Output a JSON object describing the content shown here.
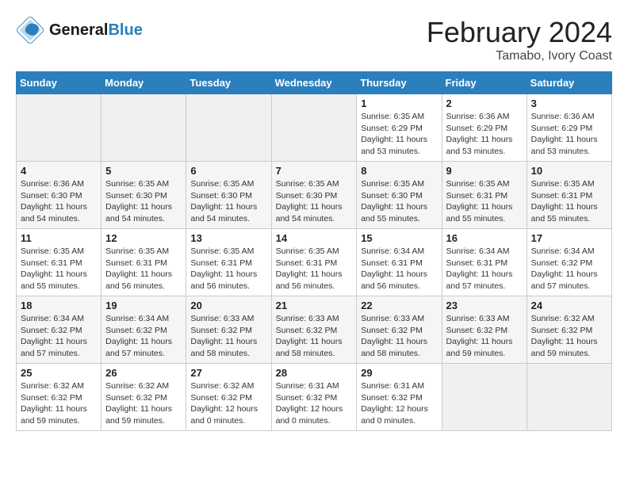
{
  "header": {
    "logo_line1": "General",
    "logo_line2": "Blue",
    "title": "February 2024",
    "subtitle": "Tamabo, Ivory Coast"
  },
  "days_of_week": [
    "Sunday",
    "Monday",
    "Tuesday",
    "Wednesday",
    "Thursday",
    "Friday",
    "Saturday"
  ],
  "weeks": [
    [
      {
        "day": "",
        "empty": true
      },
      {
        "day": "",
        "empty": true
      },
      {
        "day": "",
        "empty": true
      },
      {
        "day": "",
        "empty": true
      },
      {
        "day": "1",
        "sunrise": "Sunrise: 6:35 AM",
        "sunset": "Sunset: 6:29 PM",
        "daylight": "Daylight: 11 hours and 53 minutes."
      },
      {
        "day": "2",
        "sunrise": "Sunrise: 6:36 AM",
        "sunset": "Sunset: 6:29 PM",
        "daylight": "Daylight: 11 hours and 53 minutes."
      },
      {
        "day": "3",
        "sunrise": "Sunrise: 6:36 AM",
        "sunset": "Sunset: 6:29 PM",
        "daylight": "Daylight: 11 hours and 53 minutes."
      }
    ],
    [
      {
        "day": "4",
        "sunrise": "Sunrise: 6:36 AM",
        "sunset": "Sunset: 6:30 PM",
        "daylight": "Daylight: 11 hours and 54 minutes."
      },
      {
        "day": "5",
        "sunrise": "Sunrise: 6:35 AM",
        "sunset": "Sunset: 6:30 PM",
        "daylight": "Daylight: 11 hours and 54 minutes."
      },
      {
        "day": "6",
        "sunrise": "Sunrise: 6:35 AM",
        "sunset": "Sunset: 6:30 PM",
        "daylight": "Daylight: 11 hours and 54 minutes."
      },
      {
        "day": "7",
        "sunrise": "Sunrise: 6:35 AM",
        "sunset": "Sunset: 6:30 PM",
        "daylight": "Daylight: 11 hours and 54 minutes."
      },
      {
        "day": "8",
        "sunrise": "Sunrise: 6:35 AM",
        "sunset": "Sunset: 6:30 PM",
        "daylight": "Daylight: 11 hours and 55 minutes."
      },
      {
        "day": "9",
        "sunrise": "Sunrise: 6:35 AM",
        "sunset": "Sunset: 6:31 PM",
        "daylight": "Daylight: 11 hours and 55 minutes."
      },
      {
        "day": "10",
        "sunrise": "Sunrise: 6:35 AM",
        "sunset": "Sunset: 6:31 PM",
        "daylight": "Daylight: 11 hours and 55 minutes."
      }
    ],
    [
      {
        "day": "11",
        "sunrise": "Sunrise: 6:35 AM",
        "sunset": "Sunset: 6:31 PM",
        "daylight": "Daylight: 11 hours and 55 minutes."
      },
      {
        "day": "12",
        "sunrise": "Sunrise: 6:35 AM",
        "sunset": "Sunset: 6:31 PM",
        "daylight": "Daylight: 11 hours and 56 minutes."
      },
      {
        "day": "13",
        "sunrise": "Sunrise: 6:35 AM",
        "sunset": "Sunset: 6:31 PM",
        "daylight": "Daylight: 11 hours and 56 minutes."
      },
      {
        "day": "14",
        "sunrise": "Sunrise: 6:35 AM",
        "sunset": "Sunset: 6:31 PM",
        "daylight": "Daylight: 11 hours and 56 minutes."
      },
      {
        "day": "15",
        "sunrise": "Sunrise: 6:34 AM",
        "sunset": "Sunset: 6:31 PM",
        "daylight": "Daylight: 11 hours and 56 minutes."
      },
      {
        "day": "16",
        "sunrise": "Sunrise: 6:34 AM",
        "sunset": "Sunset: 6:31 PM",
        "daylight": "Daylight: 11 hours and 57 minutes."
      },
      {
        "day": "17",
        "sunrise": "Sunrise: 6:34 AM",
        "sunset": "Sunset: 6:32 PM",
        "daylight": "Daylight: 11 hours and 57 minutes."
      }
    ],
    [
      {
        "day": "18",
        "sunrise": "Sunrise: 6:34 AM",
        "sunset": "Sunset: 6:32 PM",
        "daylight": "Daylight: 11 hours and 57 minutes."
      },
      {
        "day": "19",
        "sunrise": "Sunrise: 6:34 AM",
        "sunset": "Sunset: 6:32 PM",
        "daylight": "Daylight: 11 hours and 57 minutes."
      },
      {
        "day": "20",
        "sunrise": "Sunrise: 6:33 AM",
        "sunset": "Sunset: 6:32 PM",
        "daylight": "Daylight: 11 hours and 58 minutes."
      },
      {
        "day": "21",
        "sunrise": "Sunrise: 6:33 AM",
        "sunset": "Sunset: 6:32 PM",
        "daylight": "Daylight: 11 hours and 58 minutes."
      },
      {
        "day": "22",
        "sunrise": "Sunrise: 6:33 AM",
        "sunset": "Sunset: 6:32 PM",
        "daylight": "Daylight: 11 hours and 58 minutes."
      },
      {
        "day": "23",
        "sunrise": "Sunrise: 6:33 AM",
        "sunset": "Sunset: 6:32 PM",
        "daylight": "Daylight: 11 hours and 59 minutes."
      },
      {
        "day": "24",
        "sunrise": "Sunrise: 6:32 AM",
        "sunset": "Sunset: 6:32 PM",
        "daylight": "Daylight: 11 hours and 59 minutes."
      }
    ],
    [
      {
        "day": "25",
        "sunrise": "Sunrise: 6:32 AM",
        "sunset": "Sunset: 6:32 PM",
        "daylight": "Daylight: 11 hours and 59 minutes."
      },
      {
        "day": "26",
        "sunrise": "Sunrise: 6:32 AM",
        "sunset": "Sunset: 6:32 PM",
        "daylight": "Daylight: 11 hours and 59 minutes."
      },
      {
        "day": "27",
        "sunrise": "Sunrise: 6:32 AM",
        "sunset": "Sunset: 6:32 PM",
        "daylight": "Daylight: 12 hours and 0 minutes."
      },
      {
        "day": "28",
        "sunrise": "Sunrise: 6:31 AM",
        "sunset": "Sunset: 6:32 PM",
        "daylight": "Daylight: 12 hours and 0 minutes."
      },
      {
        "day": "29",
        "sunrise": "Sunrise: 6:31 AM",
        "sunset": "Sunset: 6:32 PM",
        "daylight": "Daylight: 12 hours and 0 minutes."
      },
      {
        "day": "",
        "empty": true
      },
      {
        "day": "",
        "empty": true
      }
    ]
  ]
}
